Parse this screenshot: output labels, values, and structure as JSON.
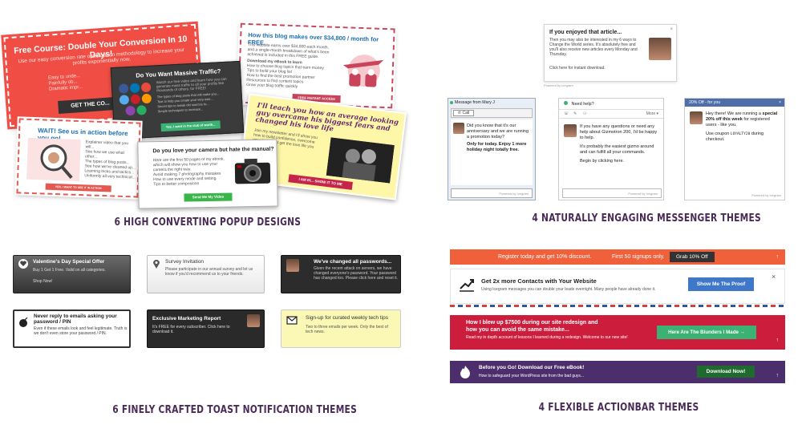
{
  "captions": {
    "popup": "6 HIGH CONVERTING POPUP DESIGNS",
    "messenger": "4 NATURALLY ENGAGING MESSENGER THEMES",
    "toast": "6 FINELY CRAFTED TOAST NOTIFICATION THEMES",
    "actionbar": "4 FLEXIBLE ACTIONBAR THEMES"
  },
  "popups": {
    "red": {
      "title": "Free Course: Double Your Conversion In 10 Days!",
      "subtitle": "Use our easy conversion rate optimization methodology to increase your profits exponentially now.",
      "lines": [
        "Easy to unde...",
        "Painfully ob...",
        "Dramatic impr..."
      ],
      "button": "GET THE CO..."
    },
    "dark": {
      "title": "Do You Want Massive Traffic?",
      "subtitle": "Watch our free video and learn how you can generate mass traffic to all your profits like thousands of others, for FREE!",
      "list": [
        "The types of blog posts that will make you...",
        "Tips to help you create your very own...",
        "Secret tips to tweak old sources to...",
        "Simple techniques to increase..."
      ],
      "button": "Yes, I want in the club of worth..."
    },
    "blog": {
      "title": "How this blog makes over $34,800 / month for FREE.",
      "body": "This website earns over $34,800 each month, and a single-month breakdown of what's been achieved is included in this FREE guide.",
      "download": "Download my eBook to learn",
      "list": [
        "How to choose blog topics that earn money",
        "Tips to build your blog list",
        "How to find the best promotion partner",
        "Resources to find content topics",
        "Grow your blog traffic quickly"
      ],
      "button": "FREE INSTANT ACCESS"
    },
    "see": {
      "title": "WAIT! See us in action before you go!",
      "list": [
        "Explainer video that you will...",
        "See how we use what other...",
        "The types of blog posts...",
        "See how we've cleaned up...",
        "Learning tricks and tactics...",
        "Uniformly all very technical..."
      ],
      "button": "YES, I WANT TO SEE IT IN ACTION"
    },
    "cam": {
      "title": "Do you love your camera but hate the manual?",
      "body": "Here are the first 50 pages of my ebook, which will show you how to use your camera the right way.",
      "list": [
        "Avoid making 7 photography mistakes",
        "How to use every mode and setting",
        "Tips to better composition"
      ],
      "button": "Send Me My Video"
    },
    "yellow": {
      "title": "I'll teach you how an average looking guy overcame his biggest fears and changed his love life",
      "body": "Join my newsletter and I'll show you how to build confidence, overcome your fears and get the love life you deserve.",
      "button": "I AM IN... SHOW IT TO ME"
    }
  },
  "messenger": {
    "top": {
      "title": "If you enjoyed that article...",
      "body": "Then you may also be interested in my 6 ways to Change the World series. It's absolutely free and you'll also receive new articles every Monday and Thursday.",
      "foot": "Click here for instant download.",
      "close": "×",
      "powered": "Powered by Icegram"
    },
    "mary": {
      "header": "Message from Mary J",
      "call": "Call",
      "text_plain": "Did you know that it's our anniversary and we are running a promotion today?",
      "text_bold": "Only for today. Enjoy 1 more holiday night totally free.",
      "powered": "Powered by Icegram"
    },
    "help": {
      "header": "Need help?",
      "more": "More ▾",
      "p1": "If you have any questions or need any help about Gizmotron 200, I'd be happy to help.",
      "p2": "It's probably the easiest gizmo around and can fulfill all your commands.",
      "p3": "Begin by clicking here.",
      "powered": "Powered by Icegram"
    },
    "offer": {
      "header": "20% Off - for you",
      "text_a": "Hey there! We are running a",
      "text_b": "special 20% off this week",
      "text_c": "for registered users - like you.",
      "text_d": "Use coupon",
      "coupon": "LOYALTY20",
      "text_e": "during checkout.",
      "powered": "Powered by Icegram"
    }
  },
  "toasts": [
    {
      "title": "Valentine's Day Special Offer",
      "body": "Buy 1 Get 1 Free. Valid on all categories.",
      "extra": "Shop Now!"
    },
    {
      "title": "Survey Invitation",
      "body": "Please participate in our annual survey and let us know if you'd recommend us to your friends."
    },
    {
      "title": "We've changed all passwords...",
      "body": "Given the recent attack on servers, we have changed everyone's password. Your password has changed too. Please click here and reset it."
    },
    {
      "title": "Never reply to emails asking your password / PIN",
      "body": "Even if these emails look and feel legitimate. Truth is we don't even store your password / PIN."
    },
    {
      "title": "Exclusive Marketing Report",
      "body": "It's FREE for every subscriber. Click here to download it."
    },
    {
      "title": "Sign-up for curated weekly tech tips",
      "body": "Two to three emails per week. Only the best of tech news."
    }
  ],
  "actionbars": {
    "bar1": {
      "text": "Register today and get 10% discount.",
      "text2": "First 50 signups only.",
      "button": "Grab 10% Off"
    },
    "bar2": {
      "title": "Get 2x more Contacts with Your Website",
      "body": "Using Icegram messages you can double your leads overnight. Many people have already done it.",
      "button": "Show Me The Proof",
      "close": "×"
    },
    "bar3": {
      "title": "How I blew up $7500 during our site redesign and how you can avoid the same mistake...",
      "body": "Read my in depth account of lessons I learned during a redesign. Welcome to our new site!",
      "button": "Here Are The Blunders I Made →"
    },
    "bar4": {
      "title": "Before you Go! Download our Free eBook!",
      "body": "How to safeguard your WordPress site from the bad guys...",
      "button": "Download Now!"
    },
    "arrow": "↑"
  },
  "colors": {
    "caption": "#4a2a57",
    "red": "#f04e45",
    "green": "#3bb273",
    "blue": "#4d6ea8",
    "orange": "#f0603a",
    "crimson": "#cc1d3d",
    "purple": "#4b2e6b"
  }
}
